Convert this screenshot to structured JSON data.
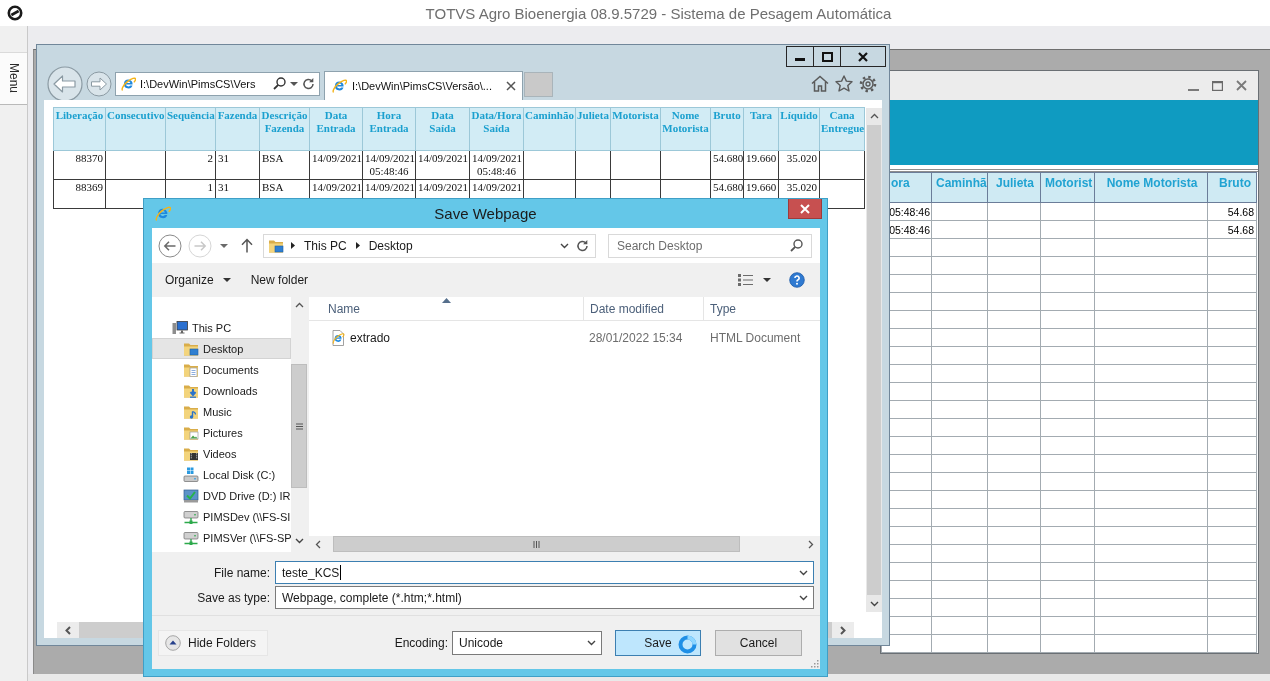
{
  "app": {
    "title": "TOTVS Agro Bioenergia 08.9.5729 - Sistema de Pesagem Automática",
    "menu_tab": "Menu"
  },
  "grid_window": {
    "columns": [
      "ora",
      "Caminhã",
      "Julieta",
      "Motorist",
      "Nome Motorista",
      "Bruto"
    ],
    "rows": [
      [
        "05:48:46",
        "",
        "",
        "",
        "",
        "54.68"
      ],
      [
        "05:48:46",
        "",
        "",
        "",
        "",
        "54.68"
      ]
    ]
  },
  "browser": {
    "address": "I:\\DevWin\\PimsCS\\Vers",
    "tabs": [
      {
        "label": "I:\\DevWin\\PimsCS\\Versão\\...",
        "selected": true
      }
    ],
    "table": {
      "columns": [
        "Liberação",
        "Consecutivo",
        "Sequência",
        "Fazenda",
        "Descrição Fazenda",
        "Data Entrada",
        "Hora Entrada",
        "Data Saída",
        "Data/Hora Saída",
        "Caminhão",
        "Julieta",
        "Motorista",
        "Nome Motorista",
        "Bruto",
        "Tara",
        "Líquido",
        "Cana Entregue"
      ],
      "rows": [
        [
          "88370",
          "",
          "2",
          "31",
          "BSA",
          "14/09/2021",
          "14/09/2021 05:48:46",
          "14/09/2021",
          "14/09/2021 05:48:46",
          "",
          "",
          "",
          "",
          "54.680",
          "19.660",
          "35.020",
          ""
        ],
        [
          "88369",
          "",
          "1",
          "31",
          "BSA",
          "14/09/2021",
          "14/09/2021",
          "14/09/2021",
          "14/09/2021",
          "",
          "",
          "",
          "",
          "54.680",
          "19.660",
          "35.020",
          ""
        ]
      ]
    }
  },
  "dialog": {
    "title": "Save Webpage",
    "nav_buttons": [
      {
        "kind": "back",
        "disabled": false
      },
      {
        "kind": "forward",
        "disabled": true
      },
      {
        "kind": "recent",
        "disabled": false
      },
      {
        "kind": "up",
        "disabled": false
      }
    ],
    "breadcrumb": [
      "This PC",
      "Desktop"
    ],
    "search": {
      "placeholder": "Search Desktop"
    },
    "toolbar": [
      {
        "label": "Organize",
        "dropdown": true
      },
      {
        "label": "New folder",
        "dropdown": false
      }
    ],
    "nav_tree": [
      {
        "label": "This PC",
        "kind": "computer",
        "selected": false,
        "children": [
          {
            "label": "Desktop",
            "kind": "desktop",
            "selected": true
          },
          {
            "label": "Documents",
            "kind": "documents",
            "selected": false
          },
          {
            "label": "Downloads",
            "kind": "downloads",
            "selected": false
          },
          {
            "label": "Music",
            "kind": "music",
            "selected": false
          },
          {
            "label": "Pictures",
            "kind": "pictures",
            "selected": false
          },
          {
            "label": "Videos",
            "kind": "videos",
            "selected": false
          },
          {
            "label": "Local Disk (C:)",
            "kind": "disk",
            "selected": false
          },
          {
            "label": "DVD Drive (D:) IR",
            "kind": "dvd",
            "selected": false
          },
          {
            "label": "PIMSDev (\\\\FS-SI",
            "kind": "network",
            "selected": false
          },
          {
            "label": "PIMSVer (\\\\FS-SP",
            "kind": "network",
            "selected": false
          }
        ]
      }
    ],
    "file_columns": [
      {
        "label": "Name",
        "sorted": true
      },
      {
        "label": "Date modified",
        "sorted": false
      },
      {
        "label": "Type",
        "sorted": false
      }
    ],
    "files": [
      {
        "name": "extrado",
        "date_modified": "28/01/2022 15:34",
        "type": "HTML Document",
        "selected": false
      }
    ],
    "file_name": {
      "label": "File name:",
      "value": "teste_KCS",
      "focused": true
    },
    "save_as_type": {
      "label": "Save as type:",
      "value": "Webpage, complete (*.htm;*.html)"
    },
    "hide_folders": "Hide Folders",
    "encoding": {
      "label": "Encoding:",
      "value": "Unicode"
    },
    "buttons": [
      {
        "label": "Save",
        "default": true
      },
      {
        "label": "Cancel",
        "default": false
      }
    ],
    "busy_cursor": true
  }
}
